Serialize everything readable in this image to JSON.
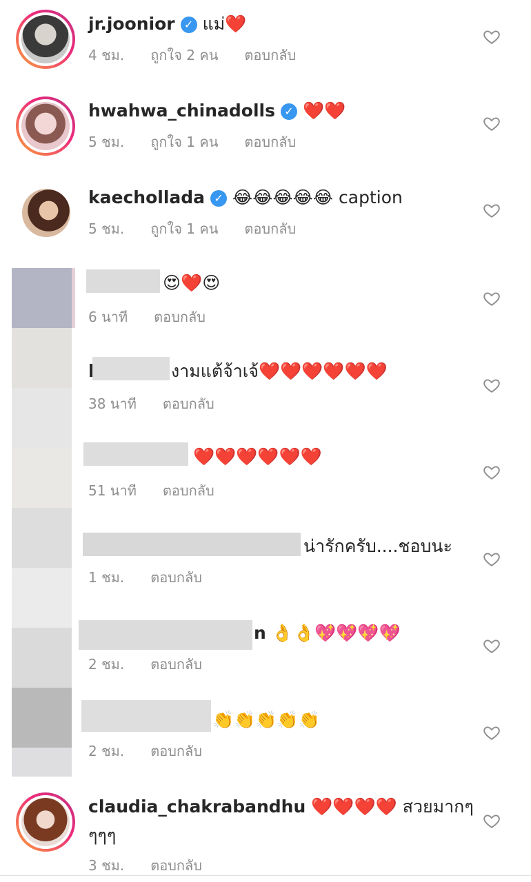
{
  "comments": [
    {
      "username": "jr.joonior",
      "text": "แม่❤️",
      "time": "4 ชม.",
      "likes": "ถูกใจ 2 คน",
      "reply": "ตอบกลับ"
    },
    {
      "username": "hwahwa_chinadolls",
      "text": "❤️❤️",
      "time": "5 ชม.",
      "likes": "ถูกใจ 1 คน",
      "reply": "ตอบกลับ"
    },
    {
      "username": "kaechollada",
      "text": "😂😂😂😂😂 caption",
      "time": "5 ชม.",
      "likes": "ถูกใจ 1 คน",
      "reply": "ตอบกลับ"
    },
    {
      "username": "",
      "text": "😍❤️😍",
      "time": "6 นาที",
      "reply": "ตอบกลับ"
    },
    {
      "username": "b",
      "text": "งามแต้จ้าเจ้❤️❤️❤️❤️❤️❤️",
      "time": "38 นาที",
      "reply": "ตอบกลับ"
    },
    {
      "username": "",
      "text": "❤️❤️❤️❤️❤️❤️",
      "time": "51 นาที",
      "reply": "ตอบกลับ"
    },
    {
      "username": "",
      "text": "น่ารักครับ....ชอบนะ",
      "time": "1 ชม.",
      "reply": "ตอบกลับ"
    },
    {
      "username": "n",
      "text": "👌👌💖💖💖💖",
      "time": "2 ชม.",
      "reply": "ตอบกลับ"
    },
    {
      "username": "",
      "text": "👏👏👏👏👏",
      "time": "2 ชม.",
      "reply": "ตอบกลับ"
    },
    {
      "username": "claudia_chakrabandhu",
      "text": "❤️❤️❤️❤️ สวยมากๆ",
      "text_cont": "ๆๆๆ",
      "time": "3 ชม.",
      "reply": "ตอบกลับ"
    }
  ],
  "icons": {
    "like": "heart-outline-icon",
    "verified": "verified-badge-icon"
  },
  "colors": {
    "verified": "#3897f0",
    "meta_text": "#8e8e8e",
    "story_ring": "#ee2a7b"
  }
}
